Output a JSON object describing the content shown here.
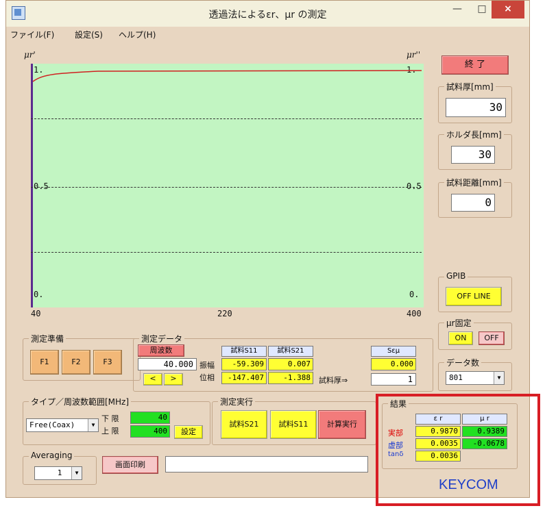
{
  "window": {
    "title": "透過法によるεr、μr の測定",
    "min_label": "—",
    "max_label": "□",
    "close_label": "×"
  },
  "menu": [
    "ファイル(F)",
    "設定(S)",
    "ヘルプ(H)"
  ],
  "plot": {
    "left_axis_title": "μr'",
    "right_axis_title": "μr''",
    "y_ticks": [
      "1.",
      "0.5",
      "0."
    ],
    "x_ticks": [
      "40",
      "220",
      "400"
    ]
  },
  "side": {
    "end_button": "終 了",
    "sample_thickness_label": "試料厚[mm]",
    "sample_thickness_value": "30",
    "holder_length_label": "ホルダ長[mm]",
    "holder_length_value": "30",
    "sample_distance_label": "試料距離[mm]",
    "sample_distance_value": "0",
    "gpib_label": "GPIB",
    "gpib_button": "OFF LINE",
    "mu_fixed_label": "μr固定",
    "mu_on": "ON",
    "mu_off": "OFF",
    "data_count_label": "データ数",
    "data_count_value": "801"
  },
  "prep": {
    "label": "測定準備",
    "f1": "F1",
    "f2": "F2",
    "f3": "F3"
  },
  "measure_data": {
    "label": "測定データ",
    "freq_label": "周波数",
    "freq_value": "40.000",
    "prev": "<",
    "next": ">",
    "amp_label": "振幅",
    "phase_label": "位相",
    "s11_label": "試料S11",
    "s21_label": "試料S21",
    "amp_s11": "-59.309",
    "amp_s21": "0.007",
    "phase_s11": "-147.407",
    "phase_s21": "-1.388",
    "seu_label": "Sεμ",
    "seu_value": "0.000",
    "thickness_arrow": "試料厚⇒",
    "thickness_value": "1"
  },
  "type_range": {
    "label": "タイプ／周波数範囲[MHz]",
    "type_value": "Free(Coax)",
    "lower_label": "下 限",
    "upper_label": "上 限",
    "lower_value": "40",
    "upper_value": "400",
    "set_button": "設定"
  },
  "run": {
    "label": "測定実行",
    "s21_button": "試料S21",
    "s11_button": "試料S11",
    "calc_button": "計算実行"
  },
  "averaging": {
    "label": "Averaging",
    "value": "1"
  },
  "print_button": "画面印刷",
  "results": {
    "label": "結果",
    "col_er": "ε r",
    "col_ur": "μ r",
    "row_real": "実部",
    "row_imag": "虚部",
    "row_tan": "tanδ",
    "er_real": "0.9870",
    "ur_real": "0.9389",
    "er_imag": "0.0035",
    "ur_imag": "-0.0678",
    "er_tan": "0.0036"
  },
  "brand": "KEYCOM"
}
